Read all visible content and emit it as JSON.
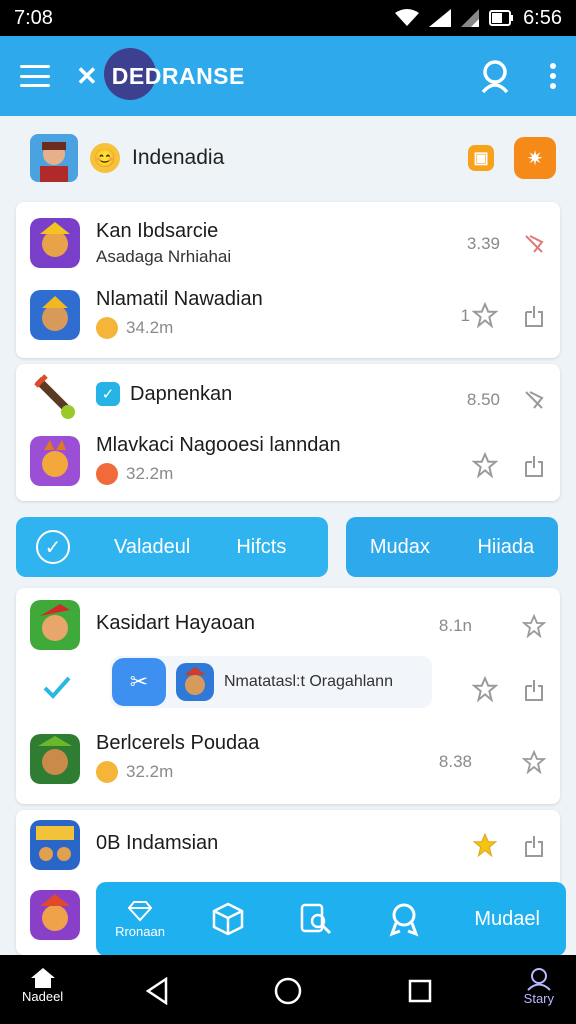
{
  "status_bar": {
    "time": "7:08",
    "clock_right": "6:56"
  },
  "app_bar": {
    "title": "DEDRANSE",
    "brand_color": "#2ea9ec"
  },
  "header": {
    "title": "Indenadia",
    "emoji": "😊"
  },
  "card1": {
    "rows": [
      {
        "title": "Kan Ibdsarcie",
        "subtitle": "Asadaga Nrhiahai",
        "number": "3.39",
        "icon": "game-icon"
      },
      {
        "title": "Nlamatil Nawadian",
        "meta": "34.2m",
        "number": "1",
        "icon": "game-icon"
      }
    ]
  },
  "card2": {
    "rows": [
      {
        "title": "Dapnenkan",
        "number": "8.50"
      },
      {
        "title": "Mlavkaci Nagooesi lanndan",
        "meta": "32.2m"
      }
    ]
  },
  "segments": {
    "left": {
      "label1": "Valadeul",
      "label2": "Hifcts"
    },
    "right": {
      "label1": "Mudax",
      "label2": "Hiiada"
    }
  },
  "card3": {
    "rows": [
      {
        "title": "Kasidart Hayaoan",
        "number": "8.1n"
      },
      {
        "chip_text": "Nmatatasl:t Oragahlann"
      },
      {
        "title": "Berlcerels Poudaa",
        "meta": "32.2m",
        "number": "8.38"
      }
    ]
  },
  "card4": {
    "rows": [
      {
        "title": "0B Indamsian"
      }
    ]
  },
  "float_bar": {
    "first_caption": "Rronaan",
    "label": "Mudael"
  },
  "nav": {
    "home_label": "Nadeel",
    "story_label": "Stary"
  }
}
